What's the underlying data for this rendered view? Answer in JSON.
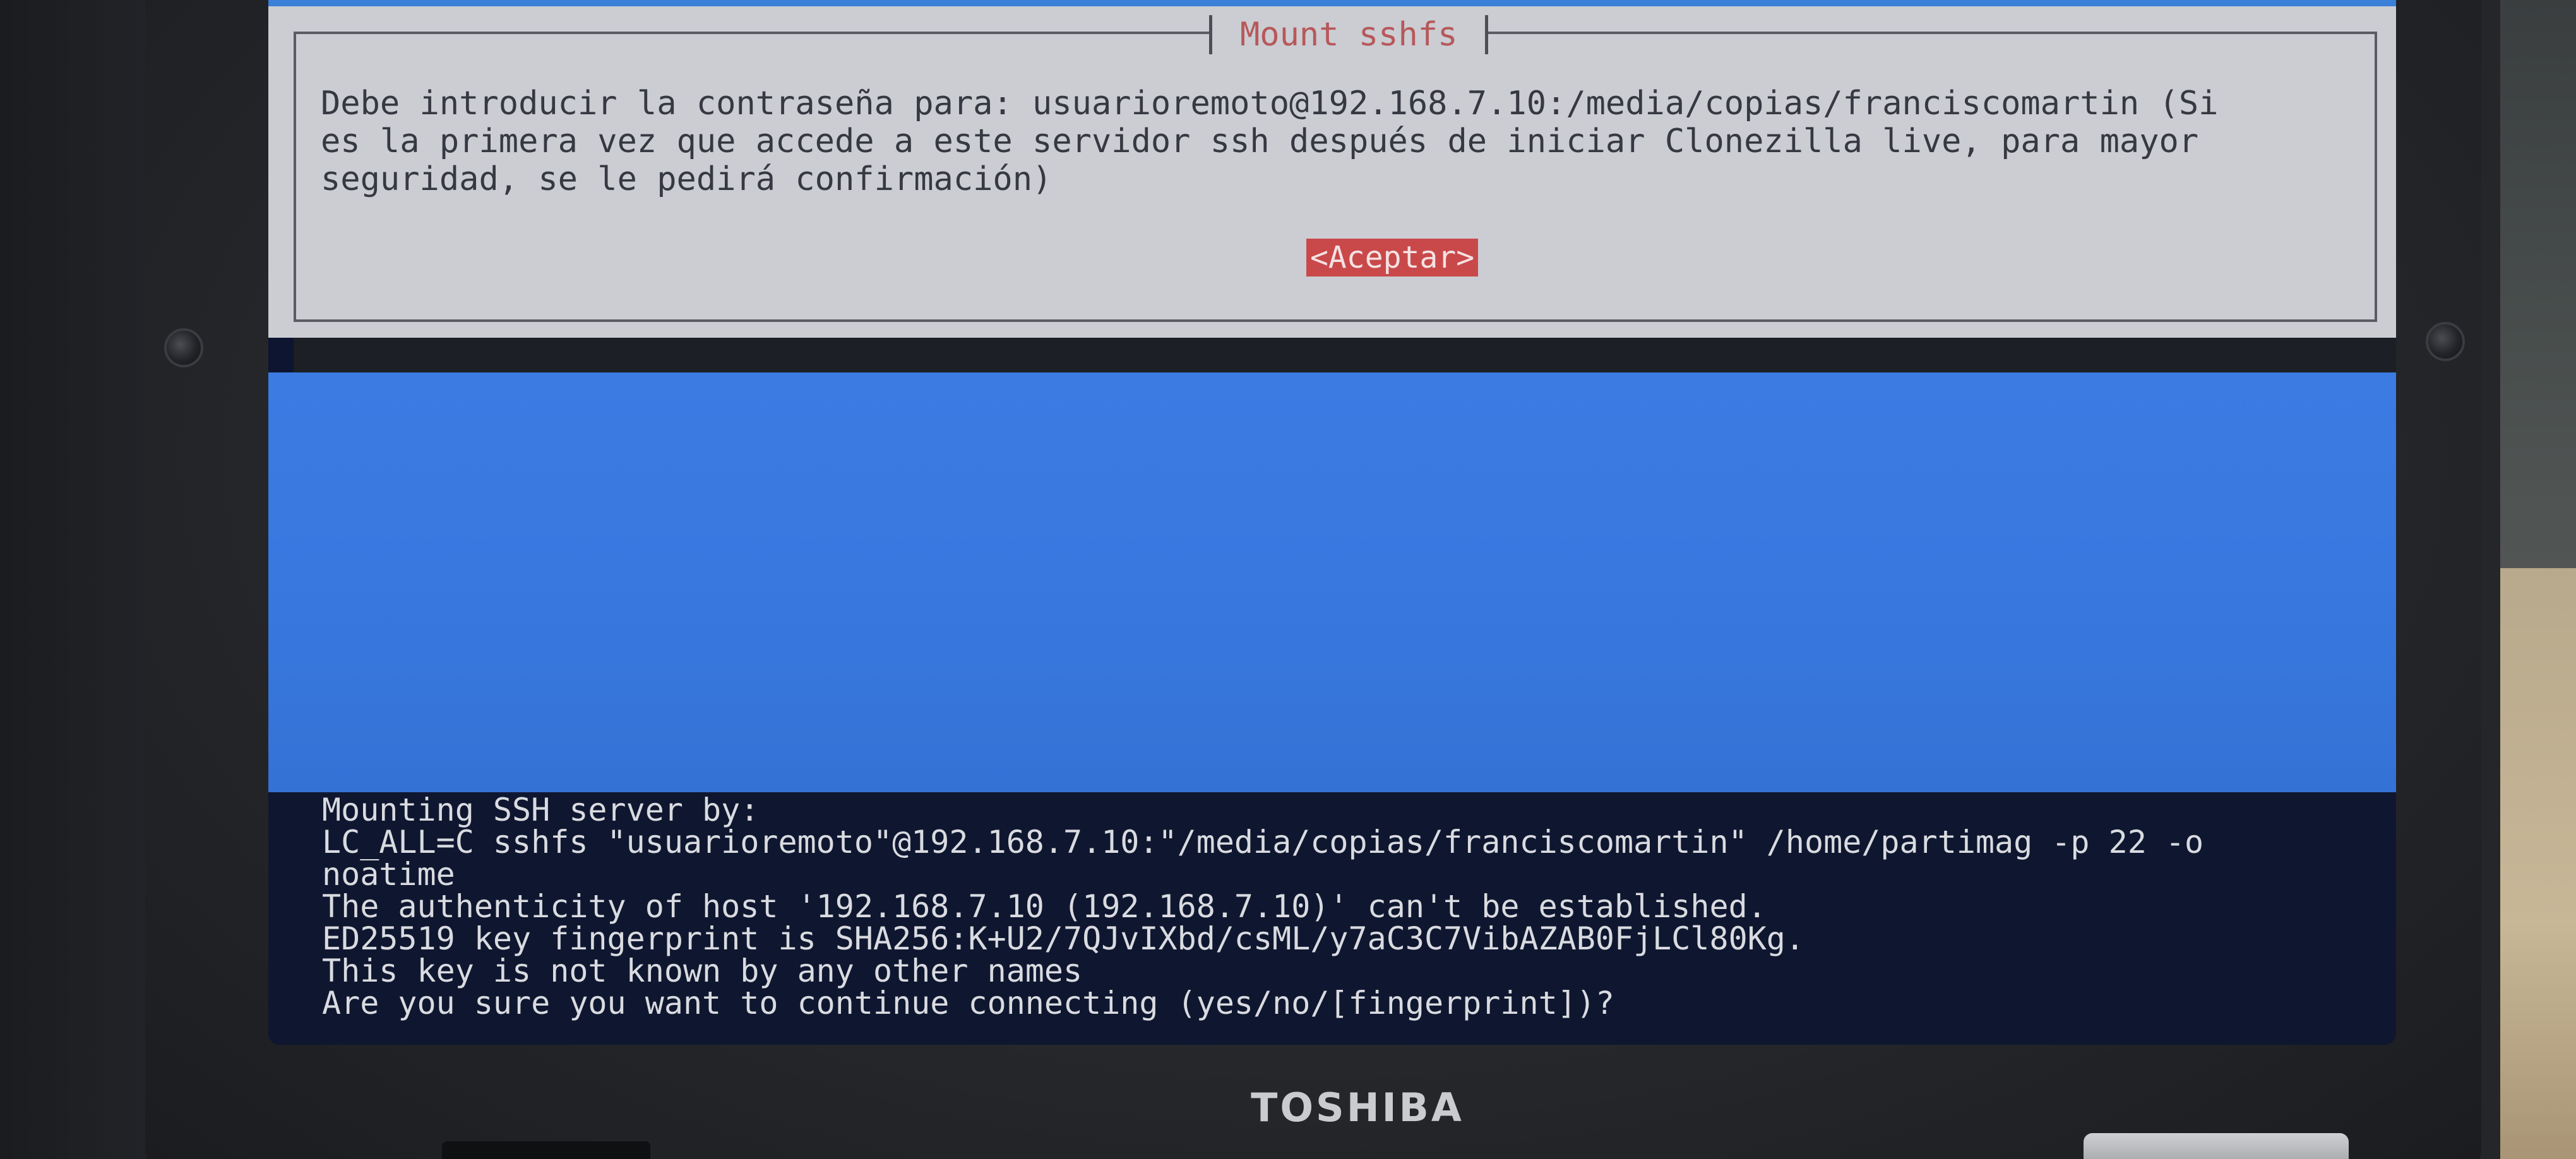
{
  "laptop": {
    "brand": "TOSHIBA"
  },
  "dialog": {
    "title": "Mount sshfs",
    "message": "Debe introducir la contraseña para: usuarioremoto@192.168.7.10:/media/copias/franciscomartin (Si\nes la primera vez que accede a este servidor ssh después de iniciar Clonezilla live, para mayor\nseguridad, se le pedirá confirmación)",
    "accept_label": "<Aceptar>"
  },
  "terminal": {
    "lines": [
      "Mounting SSH server by:",
      "LC_ALL=C sshfs \"usuarioremoto\"@192.168.7.10:\"/media/copias/franciscomartin\" /home/partimag -p 22 -o",
      "noatime",
      "The authenticity of host '192.168.7.10 (192.168.7.10)' can't be established.",
      "ED25519 key fingerprint is SHA256:K+U2/7QJvIXbd/csML/y7aC3C7VibAZAB0FjLCl80Kg.",
      "This key is not known by any other names",
      "Are you sure you want to continue connecting (yes/no/[fingerprint])?"
    ]
  },
  "colors": {
    "dialog_background": "#cbcdd3",
    "dialog_title": "#b7585a",
    "accept_button": "#c9494b",
    "desktop_blue": "#3878df",
    "terminal_background": "#0f1730",
    "terminal_text": "#d9dbe0"
  }
}
